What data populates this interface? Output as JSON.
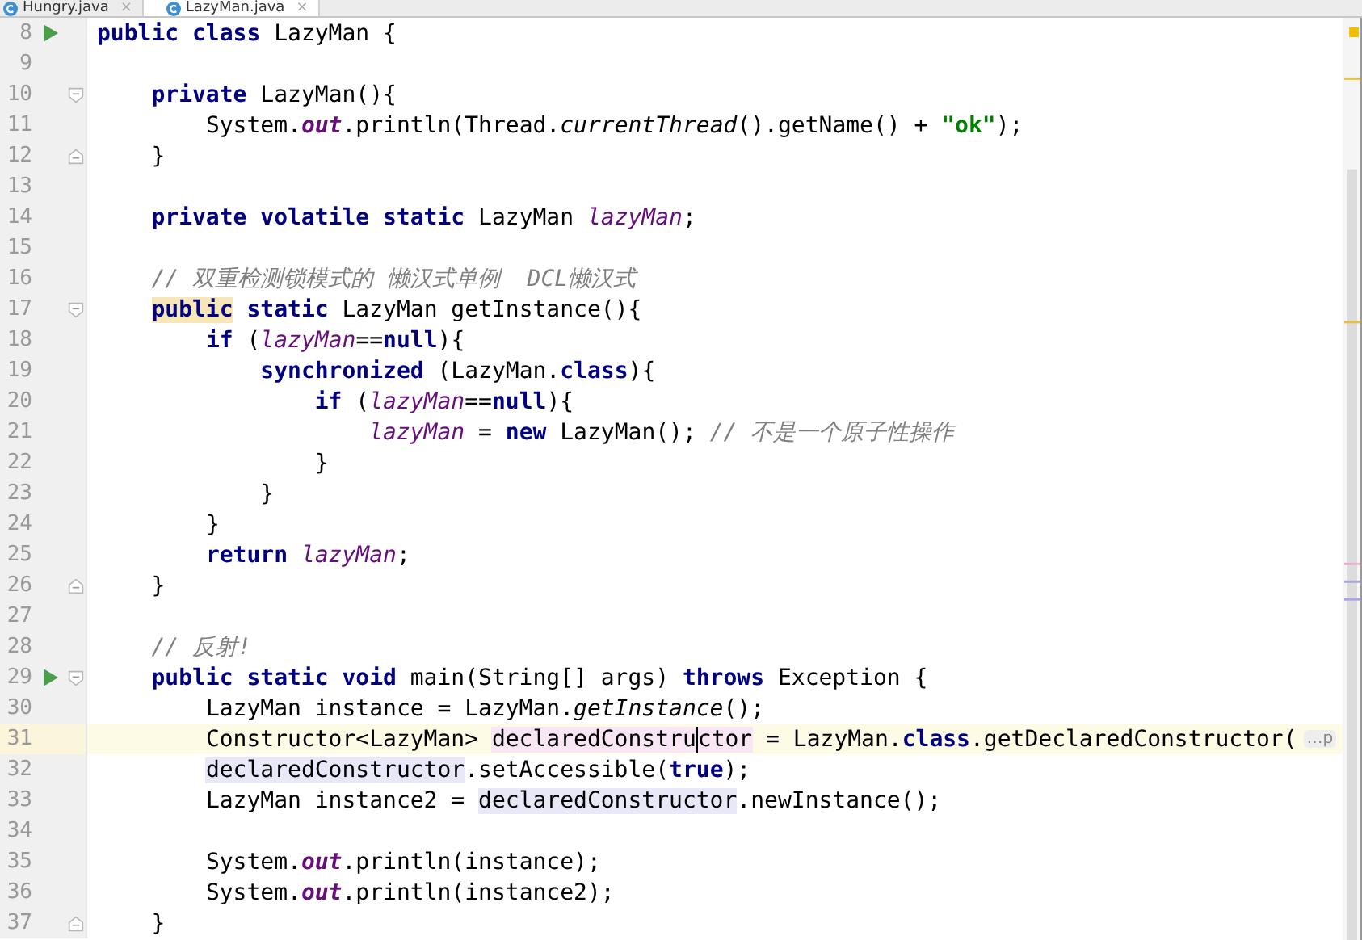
{
  "tabs": [
    {
      "label": "Hungry.java",
      "close": "×",
      "selected": false
    },
    {
      "label": "LazyMan.java",
      "close": "×",
      "selected": true
    }
  ],
  "lines": [
    {
      "number": "8",
      "run": true,
      "current": false,
      "tokens": [
        {
          "t": "public class",
          "kind": "keyword"
        },
        {
          "t": " LazyMan {",
          "kind": "plain"
        }
      ]
    },
    {
      "number": "9",
      "current": false
    },
    {
      "number": "10",
      "fold_start": true,
      "current": false,
      "tokens": [
        {
          "t": "    private",
          "kind": "keyword"
        },
        {
          "t": " LazyMan(){",
          "kind": "plain"
        }
      ]
    },
    {
      "number": "11",
      "current": false,
      "tokens": [
        {
          "t": "        System.",
          "kind": "plain"
        },
        {
          "t": "out",
          "kind": "static_field"
        },
        {
          "t": ".println(Thread.",
          "kind": "plain"
        },
        {
          "t": "currentThread",
          "kind": "static_method"
        },
        {
          "t": "().getName() + ",
          "kind": "plain"
        },
        {
          "t": "\"ok\"",
          "kind": "string"
        },
        {
          "t": ");",
          "kind": "plain"
        }
      ]
    },
    {
      "number": "12",
      "fold_end": true,
      "current": false,
      "tokens": [
        {
          "t": "    }",
          "kind": "plain"
        }
      ]
    },
    {
      "number": "13",
      "current": false
    },
    {
      "number": "14",
      "current": false,
      "tokens": [
        {
          "t": "    private volatile static",
          "kind": "keyword"
        },
        {
          "t": " LazyMan ",
          "kind": "plain"
        },
        {
          "t": "lazyMan",
          "kind": "field"
        },
        {
          "t": ";",
          "kind": "plain"
        }
      ]
    },
    {
      "number": "15",
      "current": false
    },
    {
      "number": "16",
      "current": false,
      "tokens": [
        {
          "t": "    // 双重检测锁模式的 懒汉式单例  DCL懒汉式",
          "kind": "comment"
        }
      ]
    },
    {
      "number": "17",
      "fold_start": true,
      "current": false,
      "tokens": [
        {
          "t": "    public",
          "kind": "keyword",
          "match_highlight": true
        },
        {
          "t": " static",
          "kind": "keyword"
        },
        {
          "t": " LazyMan getInstance(){",
          "kind": "plain"
        }
      ]
    },
    {
      "number": "18",
      "current": false,
      "tokens": [
        {
          "t": "        if",
          "kind": "keyword"
        },
        {
          "t": " (",
          "kind": "plain"
        },
        {
          "t": "lazyMan",
          "kind": "field"
        },
        {
          "t": "==",
          "kind": "plain"
        },
        {
          "t": "null",
          "kind": "keyword"
        },
        {
          "t": "){",
          "kind": "plain"
        }
      ]
    },
    {
      "number": "19",
      "current": false,
      "tokens": [
        {
          "t": "            synchronized",
          "kind": "keyword"
        },
        {
          "t": " (LazyMan.",
          "kind": "plain"
        },
        {
          "t": "class",
          "kind": "keyword"
        },
        {
          "t": "){",
          "kind": "plain"
        }
      ]
    },
    {
      "number": "20",
      "current": false,
      "tokens": [
        {
          "t": "                if",
          "kind": "keyword"
        },
        {
          "t": " (",
          "kind": "plain"
        },
        {
          "t": "lazyMan",
          "kind": "field"
        },
        {
          "t": "==",
          "kind": "plain"
        },
        {
          "t": "null",
          "kind": "keyword"
        },
        {
          "t": "){",
          "kind": "plain"
        }
      ]
    },
    {
      "number": "21",
      "current": false,
      "tokens": [
        {
          "t": "                    lazyMan",
          "kind": "field"
        },
        {
          "t": " = ",
          "kind": "plain"
        },
        {
          "t": "new",
          "kind": "keyword"
        },
        {
          "t": " LazyMan(); ",
          "kind": "plain"
        },
        {
          "t": "// 不是一个原子性操作",
          "kind": "comment"
        }
      ]
    },
    {
      "number": "22",
      "current": false,
      "tokens": [
        {
          "t": "                }",
          "kind": "plain"
        }
      ]
    },
    {
      "number": "23",
      "current": false,
      "tokens": [
        {
          "t": "            }",
          "kind": "plain"
        }
      ]
    },
    {
      "number": "24",
      "current": false,
      "tokens": [
        {
          "t": "        }",
          "kind": "plain"
        }
      ]
    },
    {
      "number": "25",
      "current": false,
      "tokens": [
        {
          "t": "        return",
          "kind": "keyword"
        },
        {
          "t": " lazyMan",
          "kind": "field"
        },
        {
          "t": ";",
          "kind": "plain"
        }
      ]
    },
    {
      "number": "26",
      "fold_end": true,
      "current": false,
      "tokens": [
        {
          "t": "    }",
          "kind": "plain"
        }
      ]
    },
    {
      "number": "27",
      "current": false
    },
    {
      "number": "28",
      "current": false,
      "tokens": [
        {
          "t": "    // 反射!",
          "kind": "comment"
        }
      ]
    },
    {
      "number": "29",
      "run": true,
      "fold_start": true,
      "current": false,
      "tokens": [
        {
          "t": "    public static void",
          "kind": "keyword"
        },
        {
          "t": " main(String[] args) ",
          "kind": "plain"
        },
        {
          "t": "throws",
          "kind": "keyword"
        },
        {
          "t": " Exception {",
          "kind": "plain"
        }
      ]
    },
    {
      "number": "30",
      "current": false,
      "tokens": [
        {
          "t": "        LazyMan instance = LazyMan.",
          "kind": "plain"
        },
        {
          "t": "getInstance",
          "kind": "static_method"
        },
        {
          "t": "();",
          "kind": "plain"
        }
      ]
    },
    {
      "number": "31",
      "current": true,
      "inlay": "…p",
      "tokens": [
        {
          "t": "        Constructor<LazyMan> ",
          "kind": "plain"
        },
        {
          "t": "declaredConstru",
          "kind": "plain",
          "write_highlight": true
        },
        {
          "t": "ctor",
          "kind": "plain",
          "write_highlight": true,
          "caret": true
        },
        {
          "t": " = LazyMan.",
          "kind": "plain"
        },
        {
          "t": "class",
          "kind": "keyword"
        },
        {
          "t": ".getDeclaredConstructor(",
          "kind": "plain"
        }
      ]
    },
    {
      "number": "32",
      "current": false,
      "tokens": [
        {
          "t": "        declaredConstructor",
          "kind": "plain",
          "read_highlight": true
        },
        {
          "t": ".setAccessible(",
          "kind": "plain"
        },
        {
          "t": "true",
          "kind": "keyword"
        },
        {
          "t": ");",
          "kind": "plain"
        }
      ]
    },
    {
      "number": "33",
      "current": false,
      "tokens": [
        {
          "t": "        LazyMan instance2 = ",
          "kind": "plain"
        },
        {
          "t": "declaredConstructor",
          "kind": "plain",
          "read_highlight": true
        },
        {
          "t": ".newInstance();",
          "kind": "plain"
        }
      ]
    },
    {
      "number": "34",
      "current": false
    },
    {
      "number": "35",
      "current": false,
      "tokens": [
        {
          "t": "        System.",
          "kind": "plain"
        },
        {
          "t": "out",
          "kind": "static_field"
        },
        {
          "t": ".println(instance);",
          "kind": "plain"
        }
      ]
    },
    {
      "number": "36",
      "current": false,
      "tokens": [
        {
          "t": "        System.",
          "kind": "plain"
        },
        {
          "t": "out",
          "kind": "static_field"
        },
        {
          "t": ".println(instance2);",
          "kind": "plain"
        }
      ]
    },
    {
      "number": "37",
      "fold_end": true,
      "current": false,
      "tokens": [
        {
          "t": "    }",
          "kind": "plain"
        }
      ]
    }
  ]
}
